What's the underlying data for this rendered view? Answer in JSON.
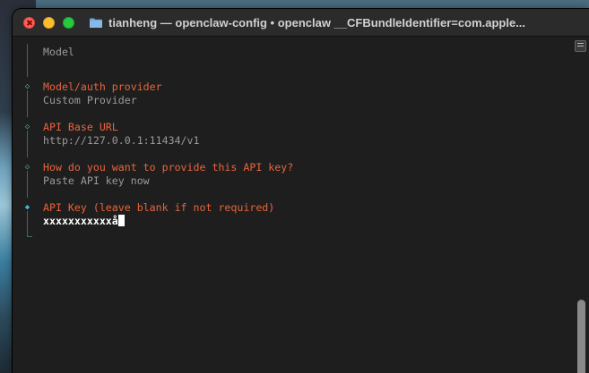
{
  "window": {
    "title": "tianheng — openclaw-config • openclaw __CFBundleIdentifier=com.apple..."
  },
  "icons": {
    "folder": "folder-icon",
    "done_marker": "diamond-outline-icon",
    "active_marker": "diamond-filled-icon"
  },
  "colors": {
    "accent_label": "#e8643c",
    "done_marker": "#3cc46e",
    "active_marker": "#3bb8d8",
    "value_text": "#9a9a9a"
  },
  "terminal": {
    "steps": [
      {
        "label": "",
        "value": "Model",
        "state": "none"
      },
      {
        "label": "Model/auth provider",
        "value": "Custom Provider",
        "state": "done"
      },
      {
        "label": "API Base URL",
        "value": "http://127.0.0.1:11434/v1",
        "state": "done"
      },
      {
        "label": "How do you want to provide this API key?",
        "value": "Paste API key now",
        "state": "done"
      },
      {
        "label": "API Key (leave blank if not required)",
        "value": "xxxxxxxxxxxå",
        "state": "active"
      }
    ],
    "markers": {
      "done": "◇",
      "active": "◆"
    }
  }
}
